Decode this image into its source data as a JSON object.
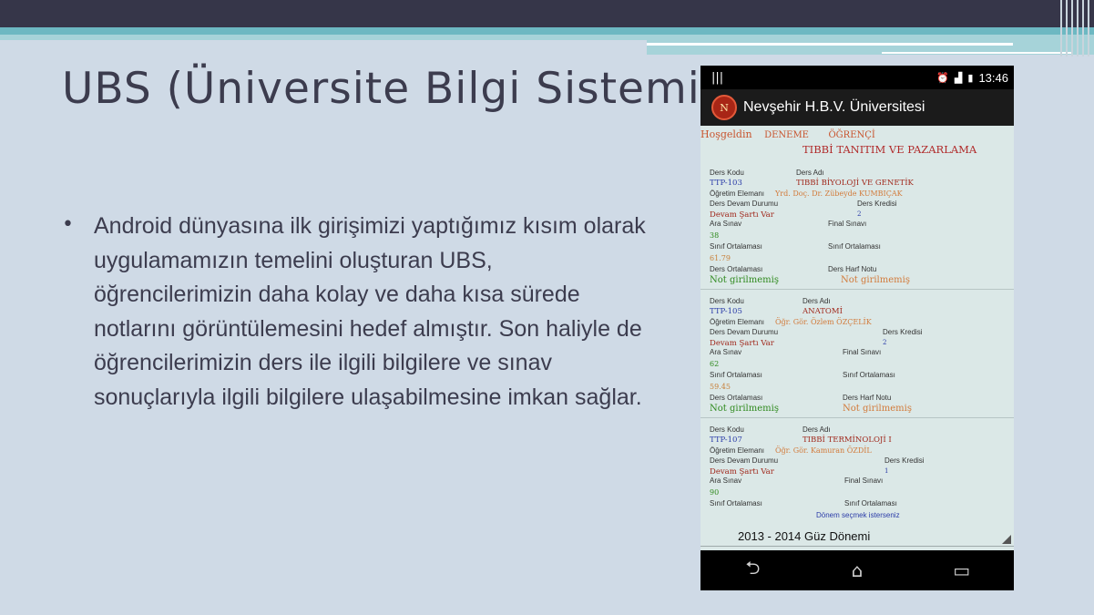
{
  "slide": {
    "title": "UBS (Üniversite Bilgi Sistemi",
    "bullet": "Android dünyasına ilk girişimizi yaptığımız kısım olarak uygulamamızın temelini oluşturan UBS, öğrencilerimizin daha kolay ve daha kısa sürede notlarını görüntülemesini hedef almıştır.  Son haliyle de öğrencilerimizin ders ile ilgili bilgilere ve sınav sonuçlarıyla ilgili bilgilere ulaşabilmesine imkan sağlar."
  },
  "phone": {
    "status": {
      "left_icon": "|||",
      "time": "13:46",
      "alarm_icon": "alarm-icon",
      "signal_icon": "signal-icon",
      "battery_icon": "battery-icon"
    },
    "app_title": "Nevşehir H.B.V. Üniversitesi",
    "logo_text": "N",
    "greeting": "Hoşgeldin",
    "student_name": "DENEME",
    "student_role": "ÖĞRENÇİ",
    "department": "TIBBİ TANITIM VE PAZARLAMA",
    "labels": {
      "code": "Ders Kodu",
      "name": "Ders Adı",
      "instructor": "Öğretim Elemanı",
      "attendance": "Ders Devam Durumu",
      "credit": "Ders Kredisi",
      "midterm": "Ara Sınav",
      "final": "Final Sınavı",
      "class_avg": "Sınıf Ortalaması",
      "class_avg2": "Sınıf Ortalaması",
      "course_avg": "Ders Ortalaması",
      "letter": "Ders Harf Notu"
    },
    "courses": [
      {
        "code": "TTP-103",
        "name": "TIBBİ BİYOLOJİ VE GENETİK",
        "instructor": "Yrd. Doç. Dr. Zübeyde KUMBIÇAK",
        "attendance": "Devam Şartı Var",
        "credit": "2",
        "midterm": "38",
        "class_avg": "61.79",
        "course_avg": "Not girilmemiş",
        "letter": "Not girilmemiş"
      },
      {
        "code": "TTP-105",
        "name": "ANATOMİ",
        "instructor": "Öğr. Gör. Özlem ÖZÇELİK",
        "attendance": "Devam Şartı Var",
        "credit": "2",
        "midterm": "62",
        "class_avg": "59.45",
        "course_avg": "Not girilmemiş",
        "letter": "Not girilmemiş"
      },
      {
        "code": "TTP-107",
        "name": "TIBBİ TERMİNOLOJİ I",
        "instructor": "Öğr. Gör. Kamuran ÖZDİL",
        "attendance": "Devam Şartı Var",
        "credit": "1",
        "midterm": "90"
      }
    ],
    "term_hint": "Dönem seçmek isterseniz",
    "term_value": "2013 - 2014 Güz Dönemi",
    "nav": {
      "back": "⮌",
      "home": "⌂",
      "recents": "▭"
    }
  }
}
